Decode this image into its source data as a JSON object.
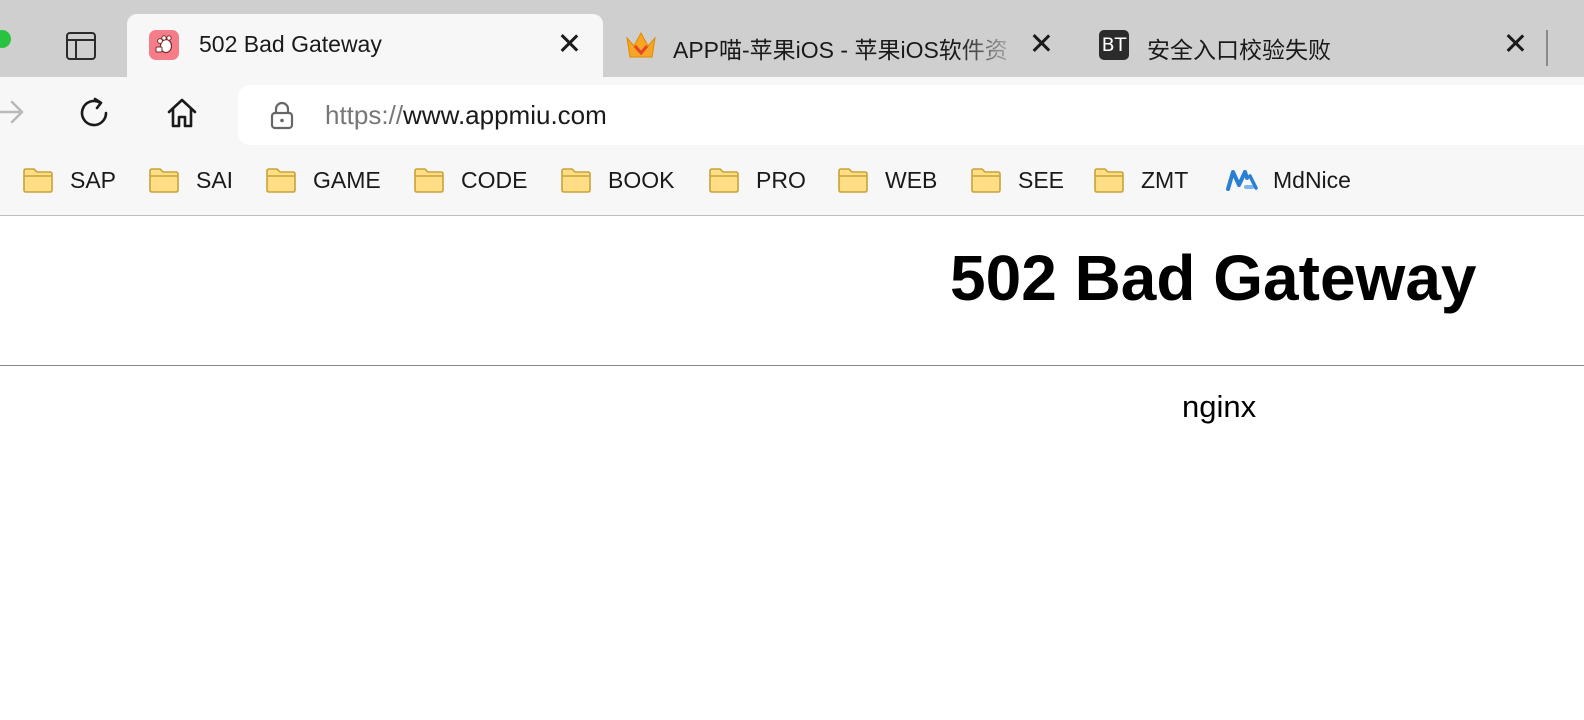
{
  "browser": {
    "tabs": [
      {
        "title": "502 Bad Gateway",
        "favicon": "appmiu-paw-icon",
        "active": true
      },
      {
        "title": "APP喵-苹果iOS - 苹果iOS软件资",
        "favicon": "crown-icon",
        "active": false
      },
      {
        "title": "安全入口校验失败",
        "favicon": "bt-icon",
        "favicon_text": "BT",
        "active": false
      }
    ],
    "address": {
      "scheme": "https://",
      "host": "www.appmiu.com"
    },
    "bookmarks": [
      {
        "label": "SAP",
        "icon": "folder-icon"
      },
      {
        "label": "SAI",
        "icon": "folder-icon"
      },
      {
        "label": "GAME",
        "icon": "folder-icon"
      },
      {
        "label": "CODE",
        "icon": "folder-icon"
      },
      {
        "label": "BOOK",
        "icon": "folder-icon"
      },
      {
        "label": "PRO",
        "icon": "folder-icon"
      },
      {
        "label": "WEB",
        "icon": "folder-icon"
      },
      {
        "label": "SEE",
        "icon": "folder-icon"
      },
      {
        "label": "ZMT",
        "icon": "folder-icon"
      },
      {
        "label": "MdNice",
        "icon": "mdnice-icon"
      }
    ]
  },
  "page": {
    "title": "502 Bad Gateway",
    "footer": "nginx"
  },
  "colors": {
    "tabstrip_bg": "#cfcfcf",
    "toolbar_bg": "#f7f7f7",
    "folder_fill": "#ffde85",
    "folder_stroke": "#c9a23a",
    "mdnice_blue": "#2a7fd4"
  }
}
